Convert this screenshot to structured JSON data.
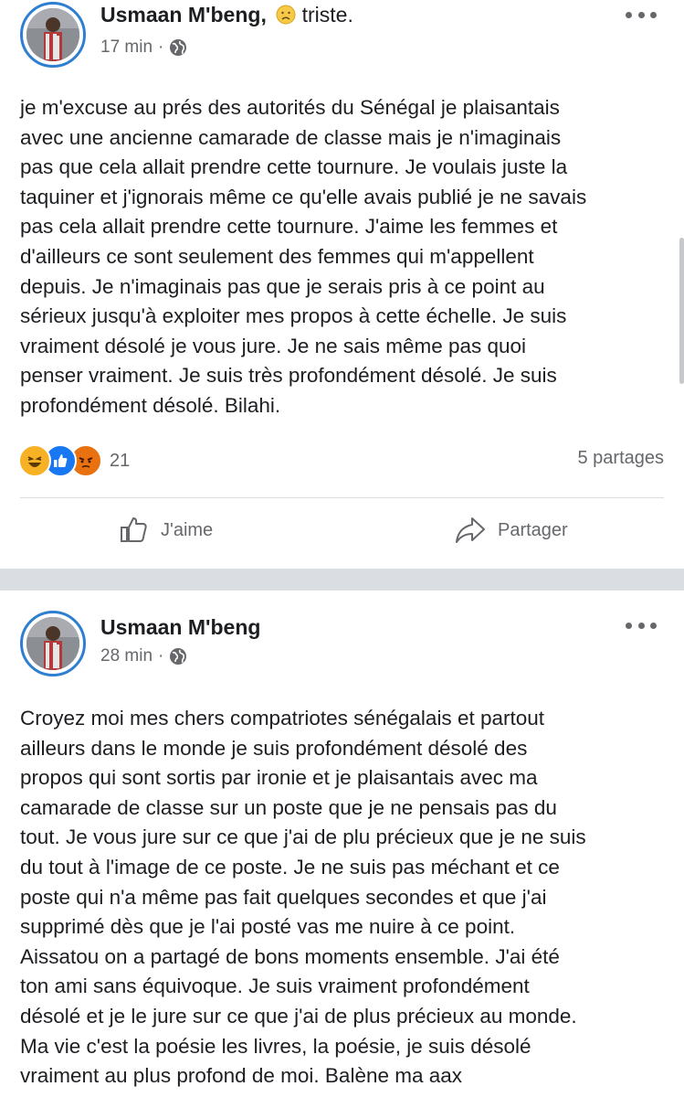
{
  "post1": {
    "author": "Usmaan M'beng,",
    "feeling": "triste.",
    "time": "17 min",
    "privacy_separator": "·",
    "text": "je m'excuse au prés des autorités du Sénégal  je plaisantais\navec une ancienne camarade de classe mais je n'imaginais\npas que cela allait prendre cette tournure. Je voulais juste la\ntaquiner et j'ignorais même ce qu'elle avais publié je ne savais\npas cela allait prendre cette tournure. J'aime les femmes et\nd'ailleurs ce sont seulement des femmes qui m'appellent\ndepuis. Je n'imaginais pas que je serais pris à ce point au\nsérieux jusqu'à exploiter mes propos à cette échelle. Je suis\nvraiment désolé je vous jure. Je ne sais même pas quoi\npenser vraiment. Je suis très profondément désolé. Je suis\nprofondément désolé. Bilahi.",
    "reaction_count": "21",
    "shares": "5 partages",
    "like_label": "J'aime",
    "share_label": "Partager",
    "reaction_icons": [
      "haha-icon",
      "like-icon",
      "angry-icon"
    ]
  },
  "post2": {
    "author": "Usmaan M'beng",
    "time": "28 min",
    "privacy_separator": "·",
    "text": "Croyez moi mes chers compatriotes sénégalais et partout\nailleurs dans le monde je suis profondément désolé des\npropos qui sont sortis par ironie et je plaisantais avec ma\ncamarade de classe sur un poste que je ne pensais pas du\ntout. Je vous jure sur ce que j'ai de plu précieux que je ne suis\ndu tout à l'image de ce poste. Je ne suis pas méchant et ce\nposte qui n'a même pas fait quelques secondes et que j'ai\nsupprimé dès que je l'ai posté vas me nuire à ce point.\nAissatou on a partagé de bons moments ensemble. J'ai été\nton ami sans équivoque. Je suis vraiment profondément\ndésolé et je le jure sur ce que j'ai de plus précieux au monde.\nMa vie c'est la poésie les livres, la poésie, je suis désolé\nvraiment au plus profond de moi. Balène ma aax"
  },
  "colors": {
    "avatar_ring": "#2f7fd0",
    "like_blue": "#1877f2",
    "angry_red": "#e9710f",
    "haha_yellow": "#f7b125",
    "separator": "#dadde1",
    "secondary_text": "#65676b"
  }
}
